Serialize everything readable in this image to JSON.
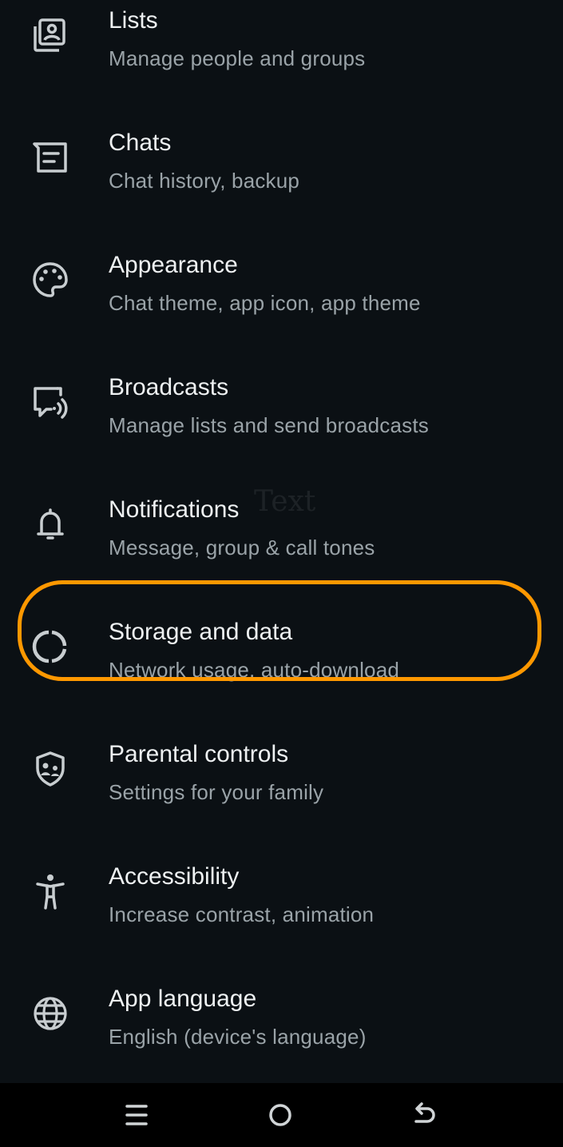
{
  "settings": {
    "items": [
      {
        "icon": "lists-icon",
        "title": "Lists",
        "subtitle": "Manage people and groups"
      },
      {
        "icon": "chat-icon",
        "title": "Chats",
        "subtitle": "Chat history, backup"
      },
      {
        "icon": "palette-icon",
        "title": "Appearance",
        "subtitle": "Chat theme, app icon, app theme"
      },
      {
        "icon": "broadcast-icon",
        "title": "Broadcasts",
        "subtitle": "Manage lists and send broadcasts"
      },
      {
        "icon": "bell-icon",
        "title": "Notifications",
        "subtitle": "Message, group & call tones"
      },
      {
        "icon": "storage-icon",
        "title": "Storage and data",
        "subtitle": "Network usage, auto-download"
      },
      {
        "icon": "shield-family-icon",
        "title": "Parental controls",
        "subtitle": "Settings for your family"
      },
      {
        "icon": "accessibility-icon",
        "title": "Accessibility",
        "subtitle": "Increase contrast, animation"
      },
      {
        "icon": "globe-icon",
        "title": "App language",
        "subtitle": "English (device's language)"
      }
    ]
  },
  "overlay": {
    "stray_text": "Text"
  },
  "colors": {
    "background": "#0b1014",
    "highlight": "#ff9800",
    "title": "#eef1f2",
    "subtitle": "#9aa3a8",
    "icon": "#c8cdd0"
  },
  "navbar": {
    "buttons": [
      "menu-icon",
      "home-icon",
      "back-icon"
    ]
  }
}
